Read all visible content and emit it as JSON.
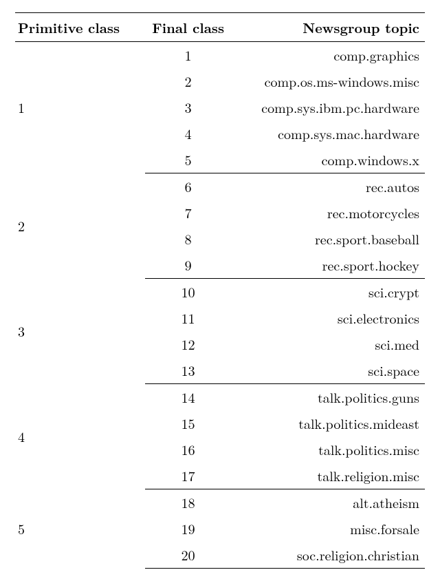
{
  "headers": {
    "primitive": "Primitive class",
    "final": "Final class",
    "topic": "Newsgroup topic"
  },
  "groups": [
    {
      "primitive": "1",
      "rows": [
        {
          "final": "1",
          "topic": "comp.graphics"
        },
        {
          "final": "2",
          "topic": "comp.os.ms-windows.misc"
        },
        {
          "final": "3",
          "topic": "comp.sys.ibm.pc.hardware"
        },
        {
          "final": "4",
          "topic": "comp.sys.mac.hardware"
        },
        {
          "final": "5",
          "topic": "comp.windows.x"
        }
      ]
    },
    {
      "primitive": "2",
      "rows": [
        {
          "final": "6",
          "topic": "rec.autos"
        },
        {
          "final": "7",
          "topic": "rec.motorcycles"
        },
        {
          "final": "8",
          "topic": "rec.sport.baseball"
        },
        {
          "final": "9",
          "topic": "rec.sport.hockey"
        }
      ]
    },
    {
      "primitive": "3",
      "rows": [
        {
          "final": "10",
          "topic": "sci.crypt"
        },
        {
          "final": "11",
          "topic": "sci.electronics"
        },
        {
          "final": "12",
          "topic": "sci.med"
        },
        {
          "final": "13",
          "topic": "sci.space"
        }
      ]
    },
    {
      "primitive": "4",
      "rows": [
        {
          "final": "14",
          "topic": "talk.politics.guns"
        },
        {
          "final": "15",
          "topic": "talk.politics.mideast"
        },
        {
          "final": "16",
          "topic": "talk.politics.misc"
        },
        {
          "final": "17",
          "topic": "talk.religion.misc"
        }
      ]
    },
    {
      "primitive": "5",
      "rows": [
        {
          "final": "18",
          "topic": "alt.atheism"
        },
        {
          "final": "19",
          "topic": "misc.forsale"
        },
        {
          "final": "20",
          "topic": "soc.religion.christian"
        }
      ]
    }
  ]
}
